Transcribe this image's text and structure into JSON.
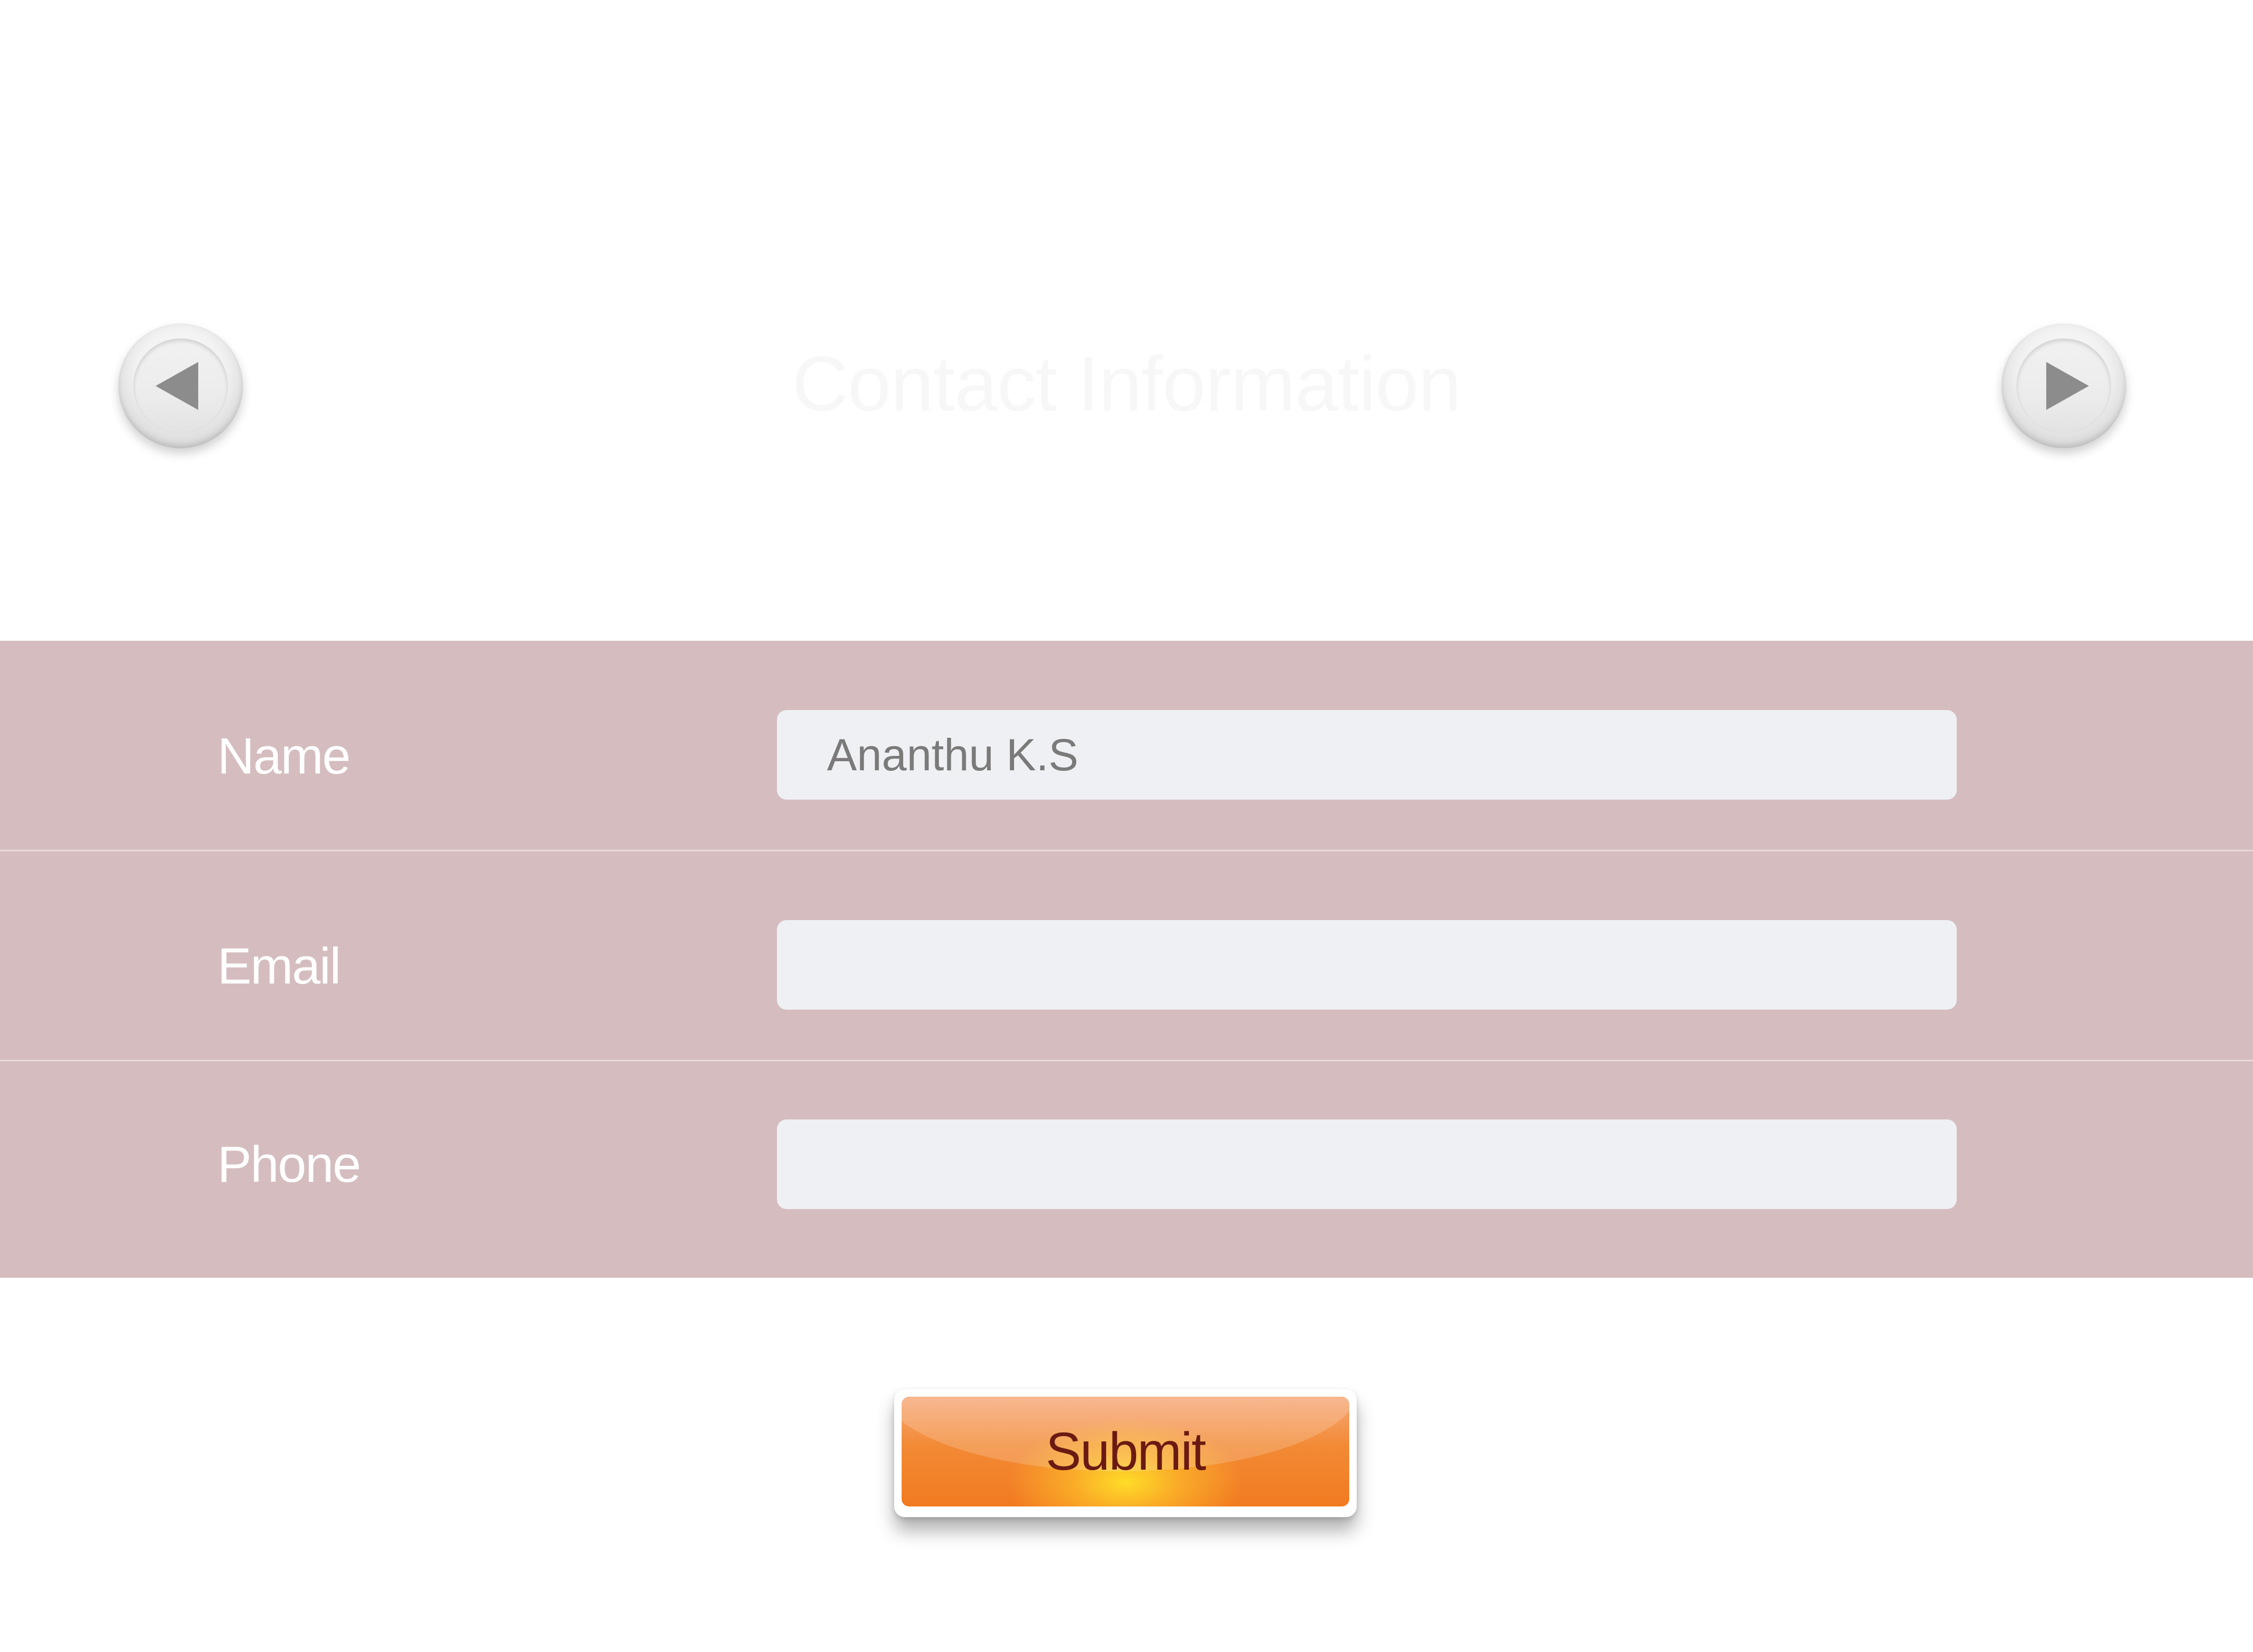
{
  "header": {
    "title": "Contact Information",
    "prev_icon": "left-arrow-icon",
    "next_icon": "right-arrow-icon"
  },
  "form": {
    "fields": [
      {
        "label": "Name",
        "value": "Ananthu K.S"
      },
      {
        "label": "Email",
        "value": ""
      },
      {
        "label": "Phone",
        "value": ""
      }
    ]
  },
  "submit": {
    "label": "Submit"
  },
  "colors": {
    "band": "#d5bdbf",
    "input_bg": "#eff0f3",
    "accent": "#f27a20",
    "submit_text": "#6b1a12"
  }
}
